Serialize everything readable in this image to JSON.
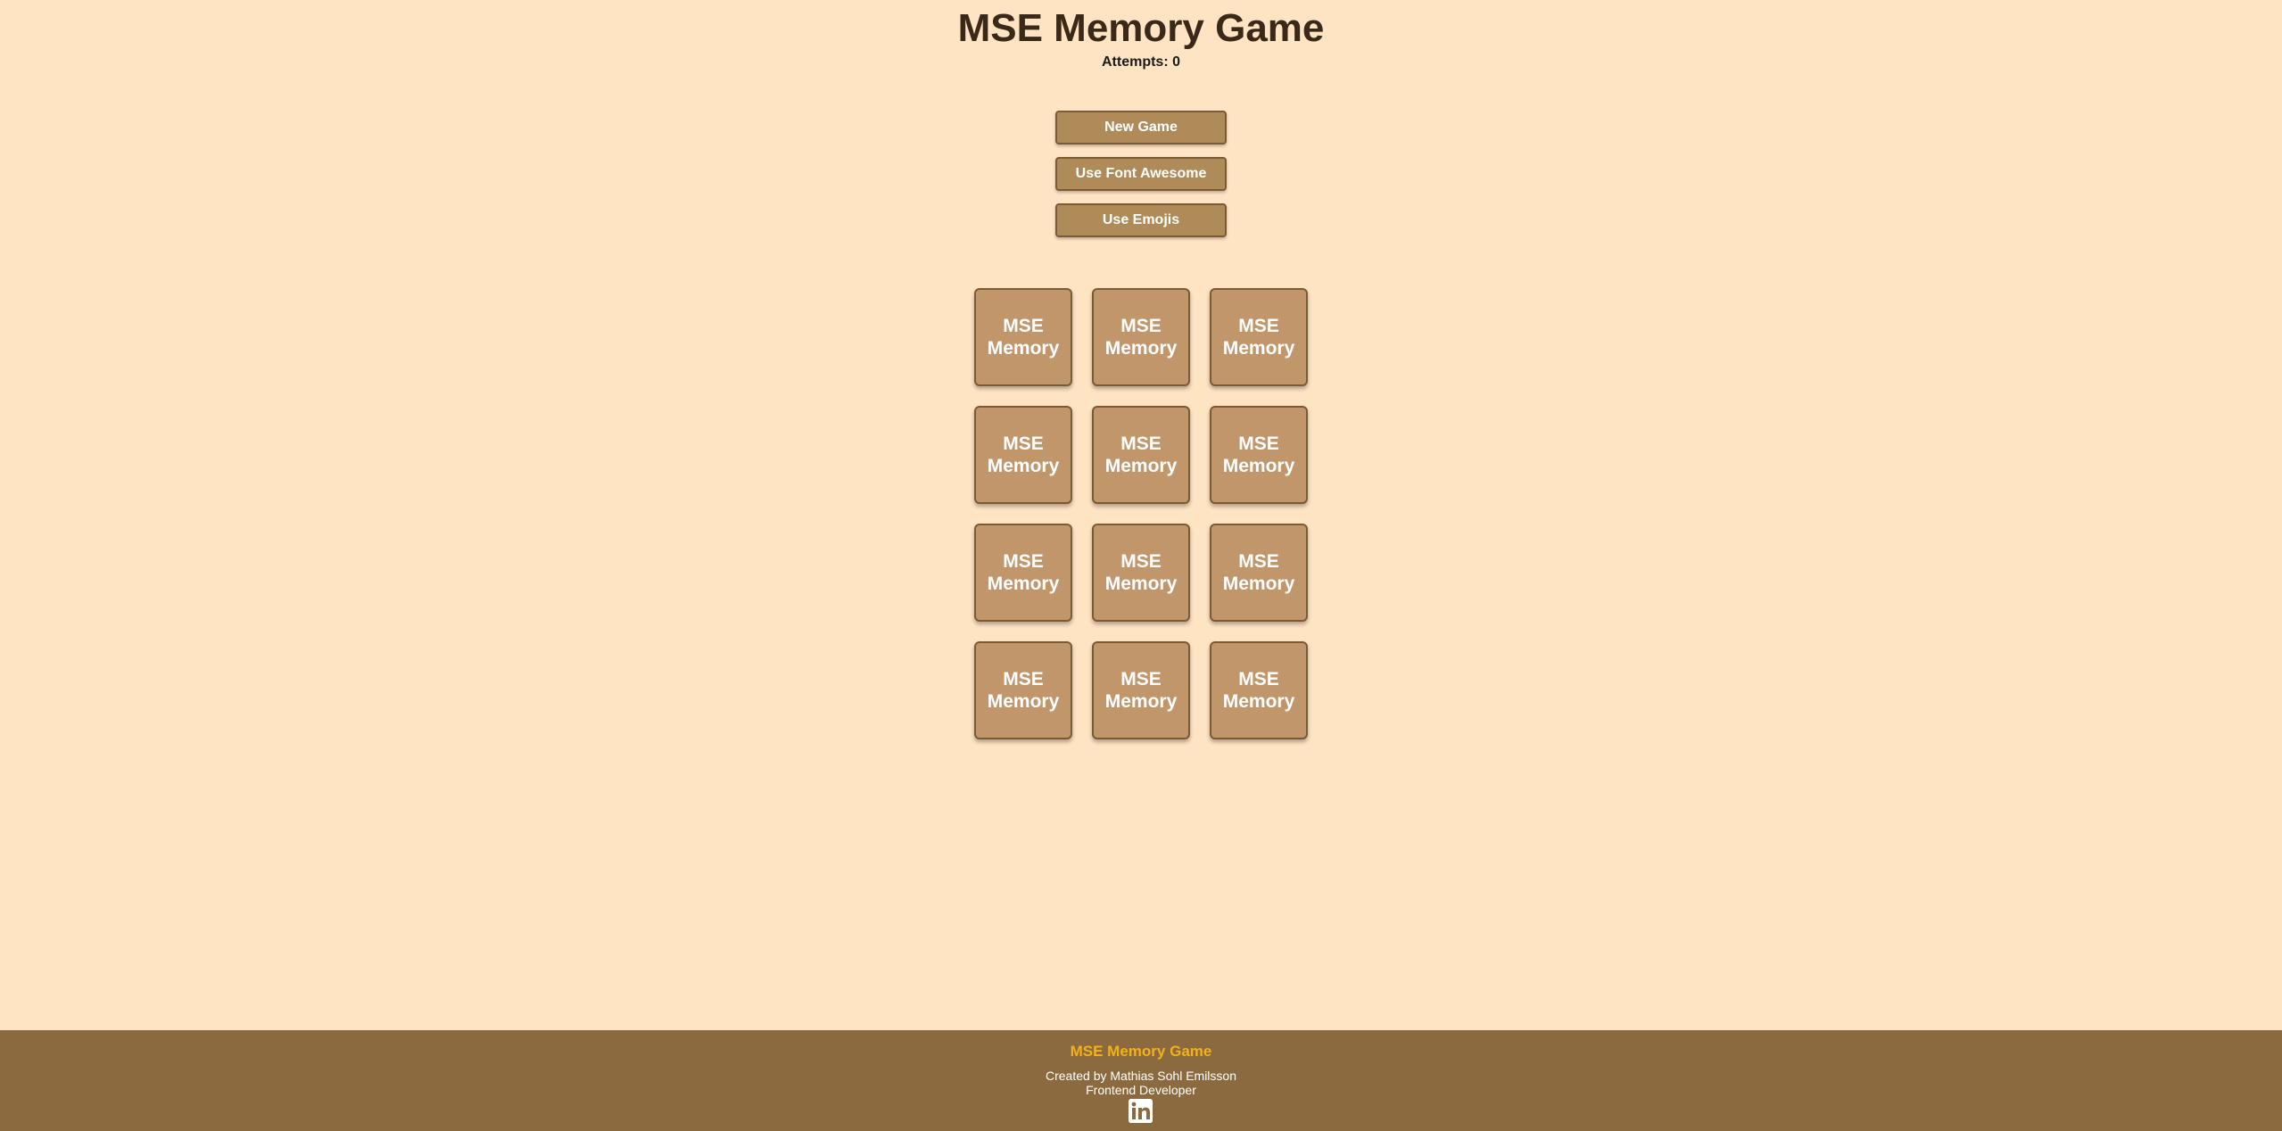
{
  "header": {
    "title": "MSE Memory Game",
    "attempts": "Attempts: 0"
  },
  "controls": [
    {
      "label": "New Game"
    },
    {
      "label": "Use Font Awesome"
    },
    {
      "label": "Use Emojis"
    }
  ],
  "board": {
    "card_back_label": "MSE\nMemory",
    "rows": 4,
    "columns": 3
  },
  "footer": {
    "title": "MSE Memory Game",
    "credit": "Created by Mathias Sohl Emilsson",
    "role": "Frontend Developer",
    "social_icon": "linkedin-icon"
  },
  "colors": {
    "background": "#ffe4c4",
    "button": "#ae8b59",
    "card": "#c1966b",
    "footer": "#8b6a40",
    "footer_title": "#f1b21a"
  }
}
